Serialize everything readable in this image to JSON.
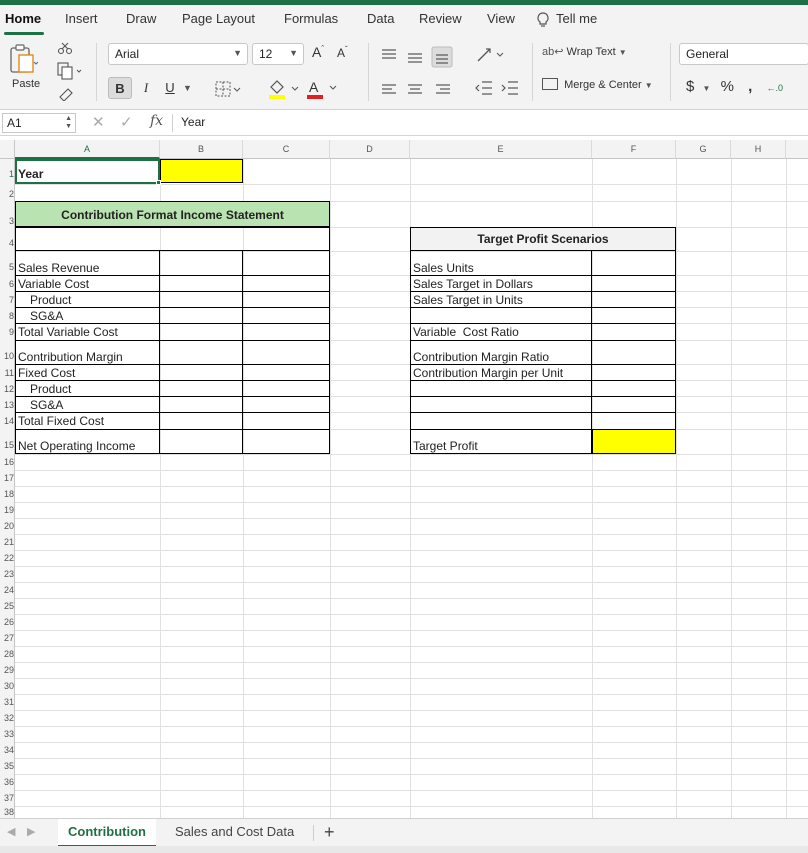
{
  "ribbon_tabs": [
    "Home",
    "Insert",
    "Draw",
    "Page Layout",
    "Formulas",
    "Data",
    "Review",
    "View"
  ],
  "tell_me": "Tell me",
  "ribbon": {
    "paste_label": "Paste",
    "font_name": "Arial",
    "font_size": "12",
    "bold": "B",
    "italic": "I",
    "underline": "U",
    "wrap_text": "Wrap Text",
    "merge_center": "Merge & Center",
    "number_format": "General",
    "currency": "$",
    "percent": "%",
    "comma": ",",
    "font_color": "#e02020",
    "highlight_color": "#ffff00",
    "accent_color": "#1e7145"
  },
  "formula_bar": {
    "name_box": "A1",
    "fx": "fx",
    "value": "Year"
  },
  "columns": [
    "A",
    "B",
    "C",
    "D",
    "E",
    "F",
    "G",
    "H"
  ],
  "rows": [
    "1",
    "2",
    "3",
    "4",
    "5",
    "6",
    "7",
    "8",
    "9",
    "10",
    "11",
    "12",
    "13",
    "14",
    "15",
    "16",
    "17",
    "18",
    "19",
    "20",
    "21",
    "22",
    "23",
    "24",
    "25",
    "26",
    "27",
    "28",
    "29",
    "30",
    "31",
    "32",
    "33",
    "34",
    "35",
    "36",
    "37",
    "38"
  ],
  "cells": {
    "year": "Year",
    "cfis_title": "Contribution Format Income Statement",
    "sales_revenue": "Sales Revenue",
    "variable_cost": "Variable Cost",
    "product_1": "Product",
    "sga_1": "SG&A",
    "total_variable_cost": "Total Variable Cost",
    "contribution_margin": "Contribution Margin",
    "fixed_cost": "Fixed Cost",
    "product_2": "Product",
    "sga_2": "SG&A",
    "total_fixed_cost": "Total Fixed Cost",
    "net_operating_income": "Net Operating Income",
    "tps_title": "Target Profit Scenarios",
    "sales_units": "Sales Units",
    "sales_target_dollars": "Sales Target in Dollars",
    "sales_target_units": "Sales Target in Units",
    "variable_cost_ratio": "Variable  Cost Ratio",
    "cm_ratio": "Contribution Margin Ratio",
    "cm_per_unit": "Contribution Margin per Unit",
    "target_profit": "Target Profit"
  },
  "sheet_tabs": [
    "Contribution",
    "Sales and Cost Data"
  ],
  "add_sheet": "+"
}
